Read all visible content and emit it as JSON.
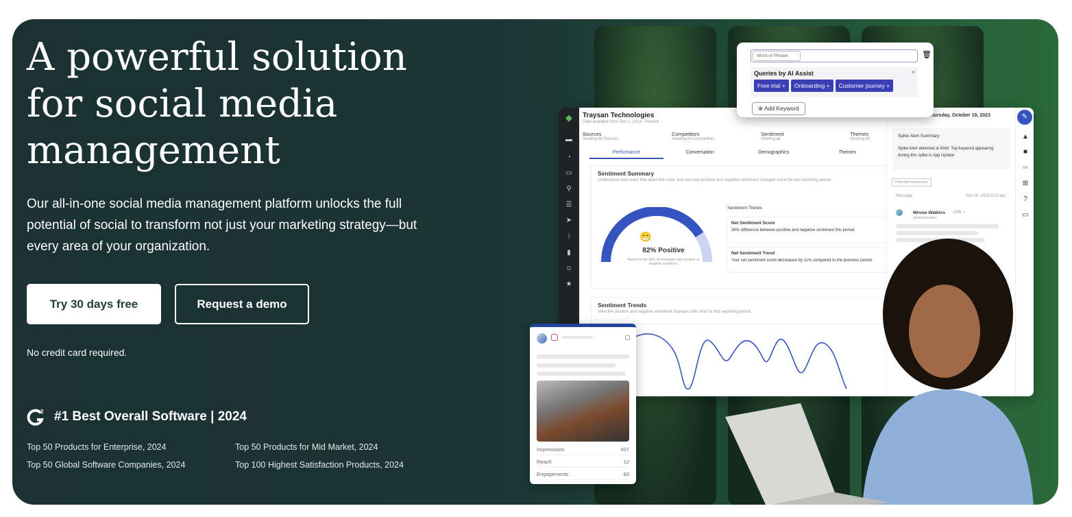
{
  "hero": {
    "title": "A powerful solution for social media management",
    "lead": "Our all-in-one social media management platform unlocks the full potential of social to transform not just your marketing strategy—but every area of your organization.",
    "primary_button": "Try 30 days free",
    "secondary_button": "Request a demo",
    "note": "No credit card required."
  },
  "awards": {
    "headline": "#1 Best Overall Software | 2024",
    "badge_text": "G2",
    "items": [
      "Top 50 Products for Enterprise, 2024",
      "Top 50 Products for Mid Market, 2024",
      "Top 50 Global Software Companies, 2024",
      "Top 100 Highest Satisfaction Products, 2024"
    ]
  },
  "popup": {
    "dropdown": "Word or Phrase",
    "title": "Queries by AI Assist",
    "chips": [
      "Free trial +",
      "Onboarding +",
      "Customer journey +"
    ],
    "add": "Add Keyword"
  },
  "dashboard": {
    "company": "Traysan Technologies",
    "subtitle": "Data available from Dec 1, 2018 - Present",
    "filters": [
      {
        "label": "Sources",
        "value": "Viewing All Sources"
      },
      {
        "label": "Competitors",
        "value": "Viewing All Competitors"
      },
      {
        "label": "Sentiment",
        "value": "Viewing all"
      },
      {
        "label": "Themes",
        "value": "Viewing All"
      }
    ],
    "tabs": [
      "Performance",
      "Conversation",
      "Demographics",
      "Themes"
    ],
    "summary_title": "Sentiment Summary",
    "summary_desc": "Understand how users feel about this topic and see how positive and negative sentiment changed since the last reporting period.",
    "gauge_value": 82,
    "gauge_label": "82% Positive",
    "gauge_note": "Based on the 56% of messages with positive or negative sentiment.",
    "trends_heading": "Sentiment Trends",
    "score_title": "Net Sentiment Score",
    "score_text": "38% difference between positive and negative sentiment this period.",
    "trend_title": "Net Sentiment Trend",
    "trend_text": "Your net sentiment score decreased by 11% compared to the previous period.",
    "trends_title": "Sentiment Trends",
    "trends_desc": "View the positive and negative sentiment changes over time for this reporting period.",
    "date": "Thursday, October 19, 2023",
    "spike_title": "Spike Alert Summary",
    "spike_text": "Spike Alert detected at 8AM. Top keyword appearing during this spike is App Update",
    "impressions_select": "Potential Impressions",
    "msg_label": "Message",
    "msg_date": "Oct 19, 2023 8:23 am",
    "user": "Minnie Watkins",
    "user_badge": "100k +",
    "handle": "@minniemakes"
  },
  "post": {
    "metrics": [
      {
        "label": "Impressions",
        "value": "437"
      },
      {
        "label": "Reach",
        "value": "12"
      },
      {
        "label": "Engagements",
        "value": "83"
      }
    ]
  },
  "colors": {
    "background": "#1b3133",
    "accent": "#3a3fb5",
    "gauge": "#3654c0"
  }
}
